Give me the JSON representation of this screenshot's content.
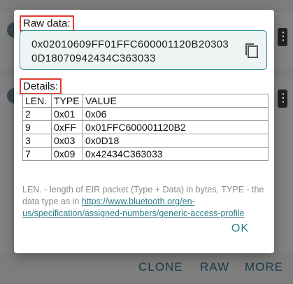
{
  "background": {
    "actions": [
      "CLONE",
      "RAW",
      "MORE"
    ],
    "menu_glyph": "⋮"
  },
  "dialog": {
    "raw_label": "Raw data:",
    "raw_value": "0x02010609FF01FFC600001120B203030D18070942434C363033",
    "copy_icon": "copy-icon",
    "details_label": "Details:",
    "table": {
      "headers": [
        "LEN.",
        "TYPE",
        "VALUE"
      ],
      "rows": [
        [
          "2",
          "0x01",
          "0x06"
        ],
        [
          "9",
          "0xFF",
          "0x01FFC600001120B2"
        ],
        [
          "3",
          "0x03",
          "0x0D18"
        ],
        [
          "7",
          "0x09",
          "0x42434C363033"
        ]
      ]
    },
    "note_text": "LEN. - length of EIR packet (Type + Data) in bytes, TYPE - the data type as in ",
    "note_link": "https://www.bluetooth.org/en-us/specification/assigned-numbers/generic-access-profile",
    "ok_label": "OK"
  },
  "colors": {
    "accent": "#2a7f8a",
    "highlight_border": "#e23a2e"
  }
}
